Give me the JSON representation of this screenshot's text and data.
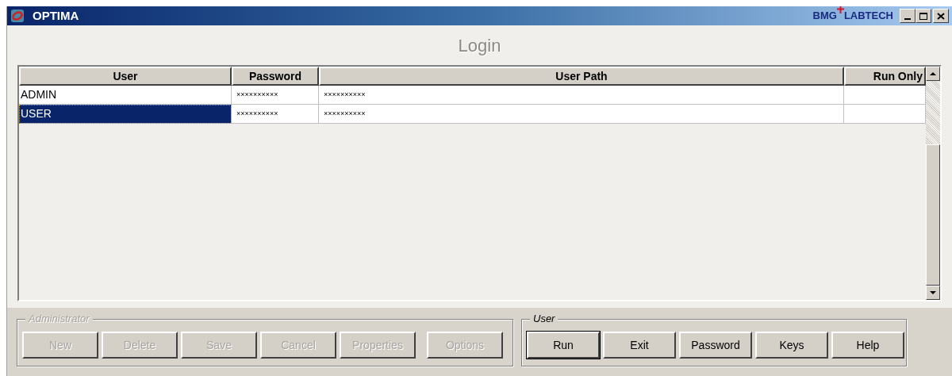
{
  "window": {
    "title": "OPTIMA",
    "brand": [
      "BMG",
      "LABTECH"
    ]
  },
  "heading": "Login",
  "table": {
    "columns": [
      "User",
      "Password",
      "User Path",
      "Run Only"
    ],
    "rows": [
      {
        "cells": [
          "ADMIN",
          "××××××××××",
          "××××××××××",
          ""
        ],
        "selected": false
      },
      {
        "cells": [
          "USER",
          "××××××××××",
          "××××××××××",
          ""
        ],
        "selected": true
      }
    ]
  },
  "groups": [
    {
      "label": "Administrator",
      "disabled": true,
      "buttons": [
        {
          "label": "New",
          "default": false
        },
        {
          "label": "Delete",
          "default": false
        },
        {
          "label": "Save",
          "default": false
        },
        {
          "label": "Cancel",
          "default": false
        },
        {
          "label": "Properties",
          "default": false
        },
        {
          "label": "Options",
          "default": false
        }
      ]
    },
    {
      "label": "User",
      "disabled": false,
      "buttons": [
        {
          "label": "Run",
          "default": true
        },
        {
          "label": "Exit",
          "default": false
        },
        {
          "label": "Password",
          "default": false
        },
        {
          "label": "Keys",
          "default": false
        },
        {
          "label": "Help",
          "default": false
        }
      ]
    }
  ]
}
